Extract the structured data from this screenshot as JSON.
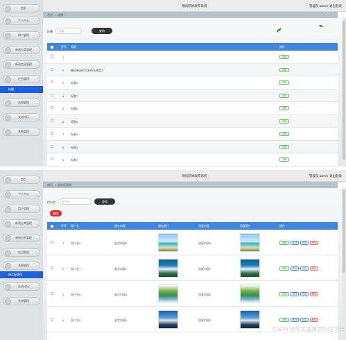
{
  "top": {
    "app_title": "晚间新闻发布系统",
    "user_label": "管理员 admin",
    "logout_label": "退出登录",
    "sidebar": [
      {
        "label": "首页"
      },
      {
        "label": "个人中心"
      },
      {
        "label": "用户管理"
      },
      {
        "label": "新闻分类管理"
      },
      {
        "label": "新闻信息管理"
      },
      {
        "label": "栏目管理"
      }
    ],
    "sidebar_active": "轮播",
    "sidebar_after": [
      {
        "label": "系统管理"
      },
      {
        "label": "交流论坛"
      },
      {
        "label": "系统管理"
      }
    ],
    "breadcrumb": {
      "home": "首页",
      "current": "轮播"
    },
    "search": {
      "label": "轮播",
      "placeholder": "轮播",
      "button": "查询"
    },
    "table": {
      "headers": [
        "序号",
        "标题",
        "操作"
      ],
      "rows": [
        {
          "index": "1",
          "title": "",
          "action": "详情"
        },
        {
          "index": "2",
          "title": "晚间新闻栏目发布系统简介",
          "action": "详情"
        },
        {
          "index": "3",
          "title": "标题8",
          "action": "详情"
        },
        {
          "index": "4",
          "title": "标题7",
          "action": "详情"
        },
        {
          "index": "5",
          "title": "标题6",
          "action": "详情"
        },
        {
          "index": "6",
          "title": "标题5",
          "action": "详情"
        },
        {
          "index": "7",
          "title": "标题4",
          "action": "详情"
        },
        {
          "index": "8",
          "title": "标题3",
          "action": "详情"
        },
        {
          "index": "9",
          "title": "标题2",
          "action": "详情"
        }
      ]
    }
  },
  "bottom": {
    "app_title": "晚间新闻发布系统",
    "user_label": "管理员 admin",
    "logout_label": "退出登录",
    "sidebar": [
      {
        "label": "首页"
      },
      {
        "label": "个人中心"
      },
      {
        "label": "用户管理"
      },
      {
        "label": "新闻分类管理"
      },
      {
        "label": "新闻信息管理"
      },
      {
        "label": "栏目管理"
      },
      {
        "label": "系统管理"
      }
    ],
    "sidebar_active": "留言板管理",
    "sidebar_after": [
      {
        "label": "交流论坛"
      },
      {
        "label": "系统管理"
      }
    ],
    "breadcrumb": {
      "home": "首页",
      "current": "留言板管理"
    },
    "search": {
      "label": "用户名",
      "placeholder": "用户名",
      "button": "查询",
      "delete": "删除"
    },
    "table": {
      "headers": [
        "序号",
        "用户名",
        "留言内容",
        "留言图片",
        "回复内容",
        "回复图片",
        "操作"
      ],
      "actions": {
        "detail": "详情",
        "edit": "修改",
        "reply": "回复",
        "delete": "删除"
      },
      "rows": [
        {
          "index": "1",
          "user": "用户名8",
          "content": "留言内容8",
          "reply": "回复内容8",
          "img": "beach"
        },
        {
          "index": "2",
          "user": "用户名7",
          "content": "留言内容7",
          "reply": "回复内容7",
          "img": "falls"
        },
        {
          "index": "3",
          "user": "用户名6",
          "content": "留言内容6",
          "reply": "回复内容6",
          "img": "forest"
        },
        {
          "index": "4",
          "user": "用户名5",
          "content": "留言内容5",
          "reply": "回复内容5",
          "img": "bay"
        }
      ]
    }
  },
  "watermark": "CSDN @IT实战课堂阿恒学长",
  "colors": {
    "accent": "#3e86df",
    "active_nav": "#1e5fe0",
    "danger": "#ea2a2a",
    "search_btn": "#333333"
  }
}
